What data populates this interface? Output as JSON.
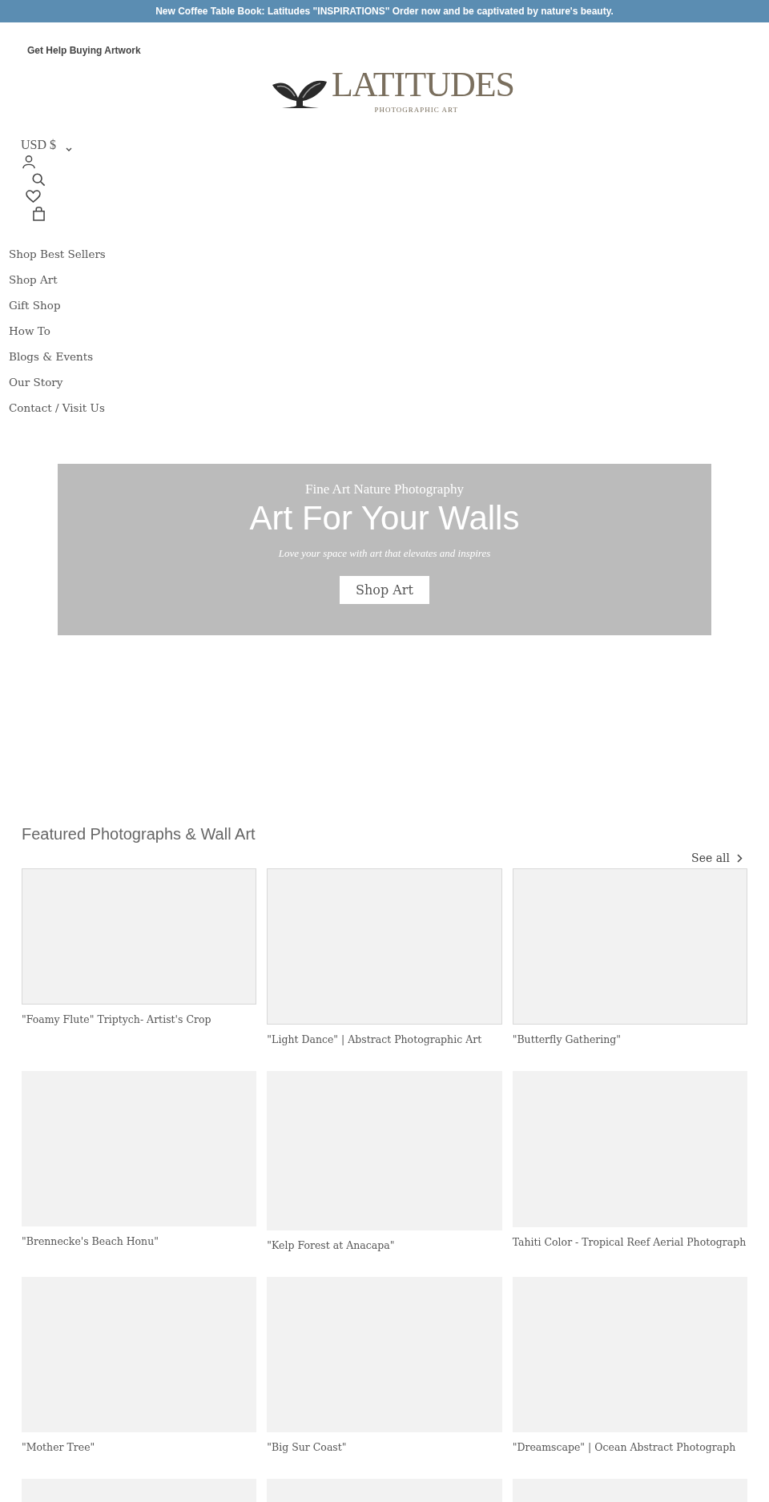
{
  "announcement": "New Coffee Table Book: Latitudes \"INSPIRATIONS\" Order now and be captivated by nature's beauty.",
  "help_link": "Get Help Buying Artwork",
  "logo": {
    "name": "LATITUDES",
    "tagline": "PHOTOGRAPHIC ART"
  },
  "currency": "USD $",
  "nav": [
    "Shop Best Sellers",
    "Shop Art",
    "Gift Shop",
    "How To",
    "Blogs & Events",
    "Our Story",
    "Contact / Visit Us"
  ],
  "hero": {
    "eyebrow": "Fine Art Nature Photography",
    "title": "Art For Your Walls",
    "subtitle": "Love your space with art that elevates and inspires",
    "button": "Shop Art"
  },
  "featured": {
    "title": "Featured Photographs & Wall Art",
    "see_all": "See all",
    "products": [
      {
        "kind": "captioned",
        "title": "\"Foamy Flute\" Triptych- Artist's Crop"
      },
      {
        "kind": "captioned",
        "title": "\"Light Dance\" | Abstract Photographic Art"
      },
      {
        "kind": "captioned",
        "title": "\"Butterfly Gathering\""
      },
      {
        "kind": "captioned",
        "title": "\"Brennecke's Beach Honu\""
      },
      {
        "kind": "captioned",
        "title": "\"Kelp Forest at Anacapa\""
      },
      {
        "kind": "captioned",
        "title": "Tahiti Color - Tropical Reef Aerial Photograph"
      },
      {
        "kind": "captioned",
        "title": "\"Mother Tree\""
      },
      {
        "kind": "captioned",
        "title": "\"Big Sur Coast\""
      },
      {
        "kind": "captioned",
        "title": "\"Dreamscape\" | Ocean Abstract Photograph"
      },
      {
        "kind": "image_only"
      },
      {
        "kind": "image_only"
      },
      {
        "kind": "image_only"
      }
    ]
  }
}
